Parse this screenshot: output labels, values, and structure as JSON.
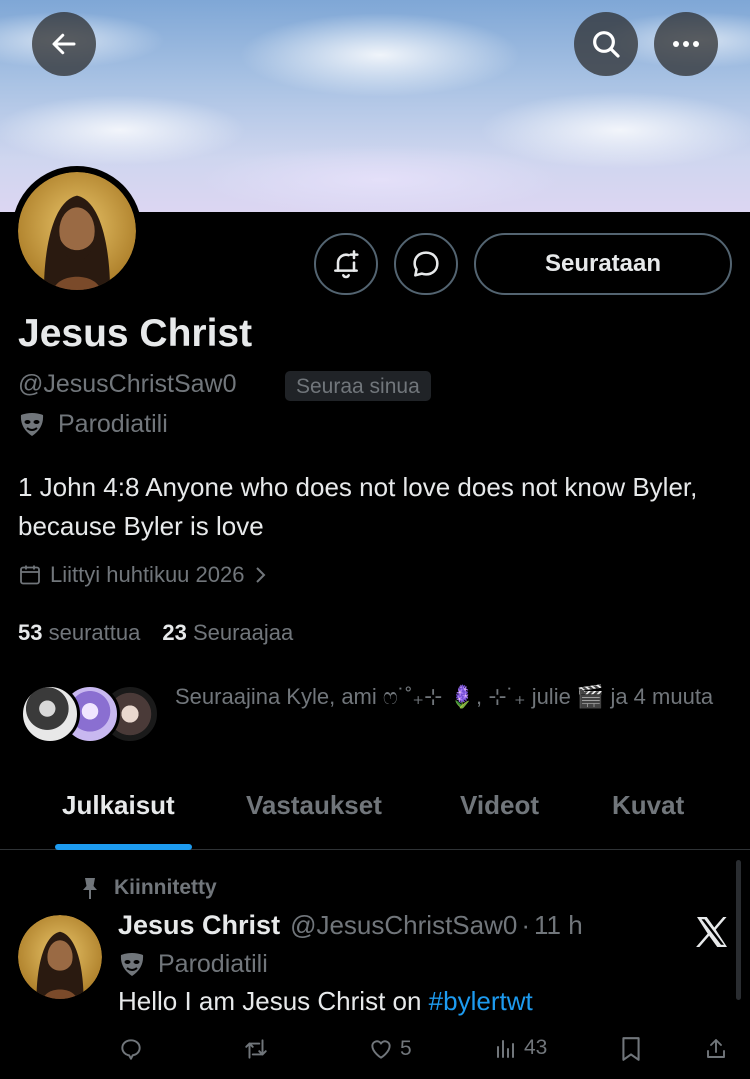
{
  "profile": {
    "name": "Jesus Christ",
    "handle": "@JesusChristSaw0",
    "follows_you_badge": "Seuraa sinua",
    "parody_label": "Parodiatili",
    "bio": "1 John 4:8 Anyone who does not love does not know Byler, because Byler is love",
    "joined": "Liittyi huhtikuu 2026",
    "following_count": "53",
    "following_label": "seurattua",
    "followers_count": "23",
    "followers_label": "Seuraajaa",
    "followed_by_text": "Seuraajina Kyle, ami ෆ˙˚₊⊹ 🪻, ⊹˙₊ julie 🎬 ja 4 muuta"
  },
  "actions": {
    "follow_button": "Seurataan"
  },
  "tabs": [
    {
      "label": "Julkaisut",
      "active": true
    },
    {
      "label": "Vastaukset",
      "active": false
    },
    {
      "label": "Videot",
      "active": false
    },
    {
      "label": "Kuvat",
      "active": false
    }
  ],
  "pinned_post": {
    "pinned_label": "Kiinnitetty",
    "author": "Jesus Christ",
    "handle": "@JesusChristSaw0",
    "separator": "·",
    "time": "11 h",
    "parody_label": "Parodiatili",
    "text": "Hello I am Jesus Christ on ",
    "hashtag": "#bylertwt",
    "likes": "5",
    "views": "43"
  },
  "colors": {
    "background": "#000000",
    "accent": "#1d9bf0",
    "text_primary": "#e7e9ea",
    "text_secondary": "#71767b",
    "border": "#2f3336"
  },
  "icons": [
    "back-arrow-icon",
    "search-icon",
    "more-icon",
    "bell-plus-icon",
    "message-icon",
    "mask-icon",
    "calendar-icon",
    "chevron-right-icon",
    "pin-icon",
    "x-logo-icon",
    "reply-icon",
    "repost-icon",
    "like-icon",
    "views-icon",
    "bookmark-icon",
    "share-icon"
  ]
}
